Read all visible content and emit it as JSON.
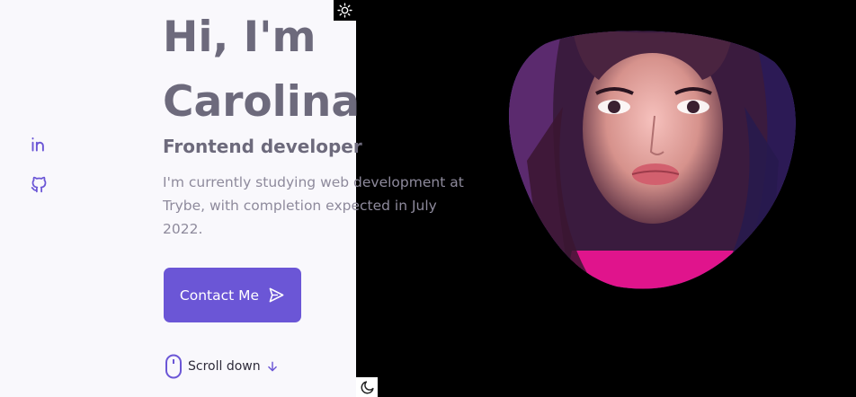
{
  "hero": {
    "greeting": "Hi, I'm",
    "name": "Carolina",
    "role": "Frontend developer",
    "description": "I'm currently studying web development at Trybe, with completion expected in July 2022.",
    "contact_label": "Contact Me",
    "scroll_label": "Scroll down"
  },
  "icons": {
    "linkedin": "linkedin-icon",
    "github": "github-icon",
    "sun": "sun-icon",
    "moon": "moon-icon",
    "send": "send-icon",
    "mouse": "mouse-icon",
    "arrow": "arrow-down-icon"
  },
  "colors": {
    "accent": "#6b56d6",
    "title": "#6d6a7c",
    "text": "#8e8a9c",
    "light_bg": "#f9f8fc",
    "dark_bg": "#000000"
  }
}
